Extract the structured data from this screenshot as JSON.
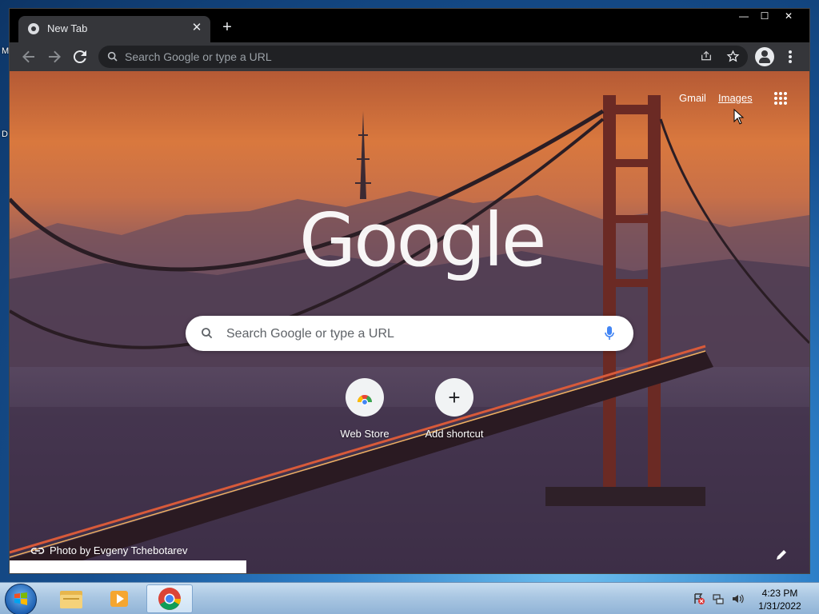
{
  "desktop": {
    "edge_letters": [
      "M",
      "D"
    ]
  },
  "browser": {
    "tab": {
      "title": "New Tab",
      "close": "✕"
    },
    "new_tab_symbol": "+",
    "window_controls": {
      "minimize": "—",
      "maximize": "☐",
      "close": "✕"
    },
    "omnibox": {
      "placeholder": "Search Google or type a URL"
    }
  },
  "ntp": {
    "links": {
      "gmail": "Gmail",
      "images": "Images"
    },
    "logo": "Google",
    "search_placeholder": "Search Google or type a URL",
    "shortcuts": [
      {
        "label": "Web Store",
        "icon": "chrome-web-store-icon"
      },
      {
        "label": "Add shortcut",
        "icon": "plus-icon",
        "symbol": "+"
      }
    ],
    "photo_credit": "Photo by Evgeny Tchebotarev"
  },
  "taskbar": {
    "clock": {
      "time": "4:23 PM",
      "date": "1/31/2022"
    },
    "pinned": [
      "file-explorer-icon",
      "media-player-icon",
      "chrome-icon"
    ]
  },
  "colors": {
    "tab_bg": "#35363a",
    "omnibox_bg": "#202124",
    "accent_text": "#e8eaed"
  }
}
